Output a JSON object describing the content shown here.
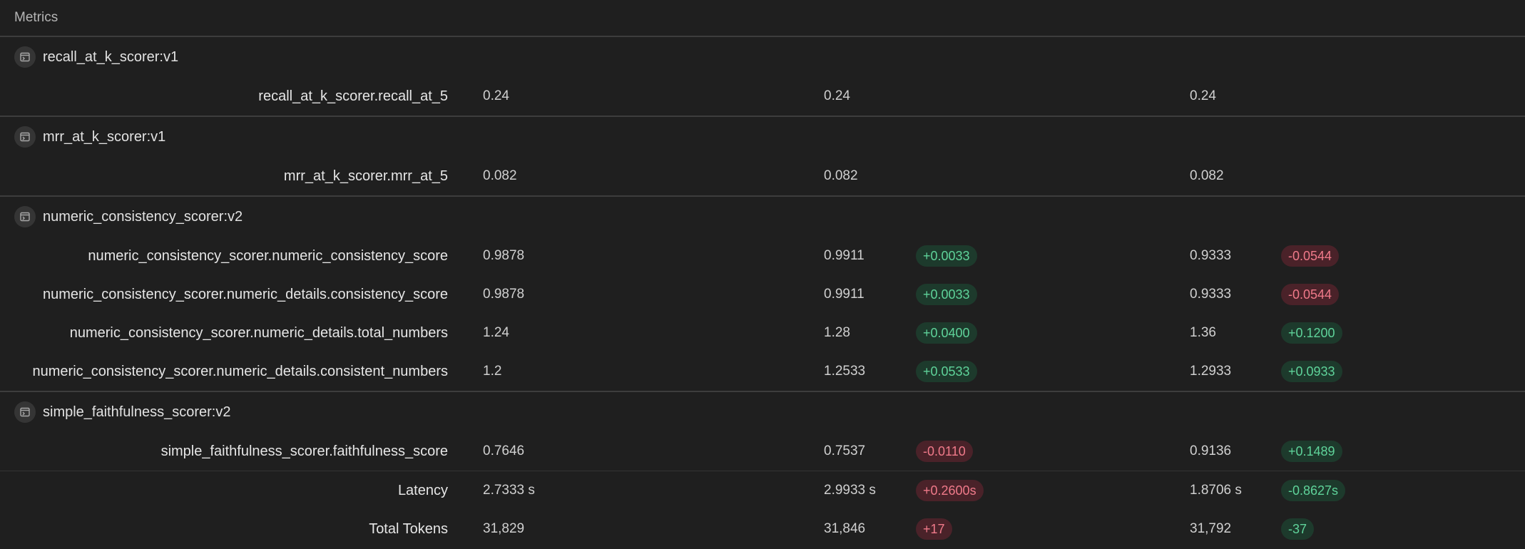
{
  "header": {
    "title": "Metrics"
  },
  "colors": {
    "good": "#5fd39a",
    "bad": "#f07a8a"
  },
  "groups": [
    {
      "title": "recall_at_k_scorer:v1",
      "icon": "scorer-icon",
      "rows": [
        {
          "label": "recall_at_k_scorer.recall_at_5",
          "v1": "0.24",
          "v2": "0.24",
          "d2": "",
          "d2_type": "",
          "v3": "0.24",
          "d3": "",
          "d3_type": ""
        }
      ]
    },
    {
      "title": "mrr_at_k_scorer:v1",
      "icon": "scorer-icon",
      "rows": [
        {
          "label": "mrr_at_k_scorer.mrr_at_5",
          "v1": "0.082",
          "v2": "0.082",
          "d2": "",
          "d2_type": "",
          "v3": "0.082",
          "d3": "",
          "d3_type": ""
        }
      ]
    },
    {
      "title": "numeric_consistency_scorer:v2",
      "icon": "scorer-icon",
      "rows": [
        {
          "label": "numeric_consistency_scorer.numeric_consistency_score",
          "v1": "0.9878",
          "v2": "0.9911",
          "d2": "+0.0033",
          "d2_type": "good",
          "v3": "0.9333",
          "d3": "-0.0544",
          "d3_type": "bad"
        },
        {
          "label": "numeric_consistency_scorer.numeric_details.consistency_score",
          "v1": "0.9878",
          "v2": "0.9911",
          "d2": "+0.0033",
          "d2_type": "good",
          "v3": "0.9333",
          "d3": "-0.0544",
          "d3_type": "bad"
        },
        {
          "label": "numeric_consistency_scorer.numeric_details.total_numbers",
          "v1": "1.24",
          "v2": "1.28",
          "d2": "+0.0400",
          "d2_type": "good",
          "v3": "1.36",
          "d3": "+0.1200",
          "d3_type": "good"
        },
        {
          "label": "numeric_consistency_scorer.numeric_details.consistent_numbers",
          "v1": "1.2",
          "v2": "1.2533",
          "d2": "+0.0533",
          "d2_type": "good",
          "v3": "1.2933",
          "d3": "+0.0933",
          "d3_type": "good"
        }
      ]
    },
    {
      "title": "simple_faithfulness_scorer:v2",
      "icon": "scorer-icon",
      "rows": [
        {
          "label": "simple_faithfulness_scorer.faithfulness_score",
          "v1": "0.7646",
          "v2": "0.7537",
          "d2": "-0.0110",
          "d2_type": "bad",
          "v3": "0.9136",
          "d3": "+0.1489",
          "d3_type": "good"
        }
      ]
    }
  ],
  "summary_rows": [
    {
      "label": "Latency",
      "v1": "2.7333 s",
      "v2": "2.9933 s",
      "d2": "+0.2600s",
      "d2_type": "bad",
      "v3": "1.8706 s",
      "d3": "-0.8627s",
      "d3_type": "good"
    },
    {
      "label": "Total Tokens",
      "v1": "31,829",
      "v2": "31,846",
      "d2": "+17",
      "d2_type": "bad",
      "v3": "31,792",
      "d3": "-37",
      "d3_type": "good"
    }
  ]
}
